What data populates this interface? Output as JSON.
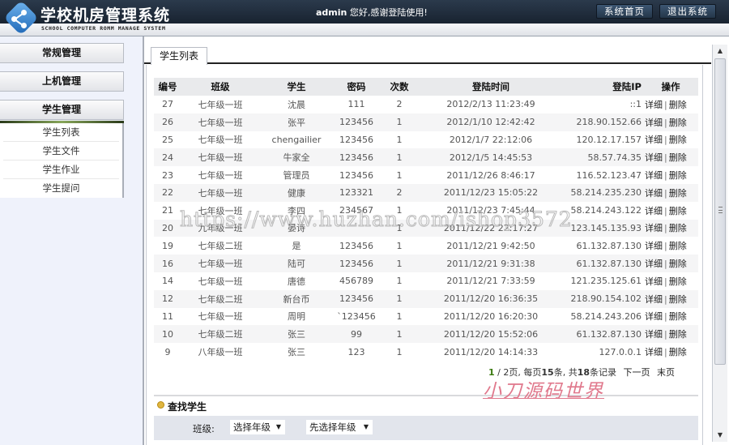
{
  "header": {
    "app_title": "学校机房管理系统",
    "app_subtitle": "SCHOOL COMPUTER ROMM MANAGE SYSTEM",
    "welcome_user": "admin",
    "welcome_text": " 您好,感谢登陆使用!",
    "buttons": {
      "home": "系统首页",
      "logout": "退出系统"
    }
  },
  "sidebar": {
    "groups": [
      {
        "label": "常规管理"
      },
      {
        "label": "上机管理"
      },
      {
        "label": "学生管理",
        "active": true
      }
    ],
    "items": [
      {
        "label": "学生列表"
      },
      {
        "label": "学生文件"
      },
      {
        "label": "学生作业"
      },
      {
        "label": "学生提问"
      }
    ]
  },
  "main": {
    "tab": "学生列表",
    "table": {
      "columns": [
        "编号",
        "班级",
        "学生",
        "密码",
        "次数",
        "登陆时间",
        "登陆IP",
        "操作"
      ],
      "action_detail": "详细",
      "action_separator": "|",
      "action_delete": "删除",
      "rows": [
        {
          "id": "27",
          "class": "七年级一班",
          "student": "沈晨",
          "password": "111",
          "count": "2",
          "login_time": "2012/2/13 11:23:49",
          "ip": "::1"
        },
        {
          "id": "26",
          "class": "七年级一班",
          "student": "张平",
          "password": "123456",
          "count": "1",
          "login_time": "2012/1/10 12:42:42",
          "ip": "218.90.152.66"
        },
        {
          "id": "25",
          "class": "七年级一班",
          "student": "chengailier",
          "password": "123456",
          "count": "1",
          "login_time": "2012/1/7 22:12:06",
          "ip": "120.12.17.157"
        },
        {
          "id": "24",
          "class": "七年级一班",
          "student": "牛家全",
          "password": "123456",
          "count": "1",
          "login_time": "2012/1/5 14:45:53",
          "ip": "58.57.74.35"
        },
        {
          "id": "23",
          "class": "七年级一班",
          "student": "管理员",
          "password": "123456",
          "count": "1",
          "login_time": "2011/12/26 8:46:17",
          "ip": "116.52.123.47"
        },
        {
          "id": "22",
          "class": "七年级一班",
          "student": "健康",
          "password": "123321",
          "count": "2",
          "login_time": "2011/12/23 15:05:22",
          "ip": "58.214.235.230"
        },
        {
          "id": "21",
          "class": "七年级一班",
          "student": "李四",
          "password": "234567",
          "count": "1",
          "login_time": "2011/12/23 7:45:44",
          "ip": "58.214.243.122"
        },
        {
          "id": "20",
          "class": "九年级一班",
          "student": "晏诗",
          "password": "",
          "count": "1",
          "login_time": "2011/12/22 22:17:27",
          "ip": "123.145.135.93"
        },
        {
          "id": "19",
          "class": "七年级二班",
          "student": "是",
          "password": "123456",
          "count": "1",
          "login_time": "2011/12/21 9:42:50",
          "ip": "61.132.87.130"
        },
        {
          "id": "16",
          "class": "七年级一班",
          "student": "陆可",
          "password": "123456",
          "count": "1",
          "login_time": "2011/12/21 9:31:38",
          "ip": "61.132.87.130"
        },
        {
          "id": "14",
          "class": "七年级一班",
          "student": "唐德",
          "password": "456789",
          "count": "1",
          "login_time": "2011/12/21 7:33:59",
          "ip": "121.235.125.61"
        },
        {
          "id": "12",
          "class": "七年级二班",
          "student": "新台币",
          "password": "123456",
          "count": "1",
          "login_time": "2011/12/20 16:36:35",
          "ip": "218.90.154.102"
        },
        {
          "id": "11",
          "class": "七年级一班",
          "student": "周明",
          "password": "`123456",
          "count": "1",
          "login_time": "2011/12/20 16:20:30",
          "ip": "58.214.243.206"
        },
        {
          "id": "10",
          "class": "七年级二班",
          "student": "张三",
          "password": "99",
          "count": "1",
          "login_time": "2011/12/20 15:52:06",
          "ip": "61.132.87.130"
        },
        {
          "id": "9",
          "class": "八年级一班",
          "student": "张三",
          "password": "123",
          "count": "1",
          "login_time": "2011/12/20 14:14:33",
          "ip": "127.0.0.1"
        }
      ]
    },
    "pager": {
      "current": "1",
      "total_pages": "2",
      "page_suffix": "页",
      "per_page_prefix": "每页",
      "per_page": "15",
      "per_page_suffix": "条",
      "total_prefix": "共",
      "total": "18",
      "total_suffix": "条记录",
      "next": "下一页",
      "last": "末页"
    },
    "search": {
      "title": "查找学生",
      "label": "班级:",
      "grade_select": "选择年级",
      "class_select": "先选择年级"
    }
  },
  "watermarks": {
    "url": "https://www.huzhan.com/ishop3572",
    "brand": "小刀源码世界"
  }
}
